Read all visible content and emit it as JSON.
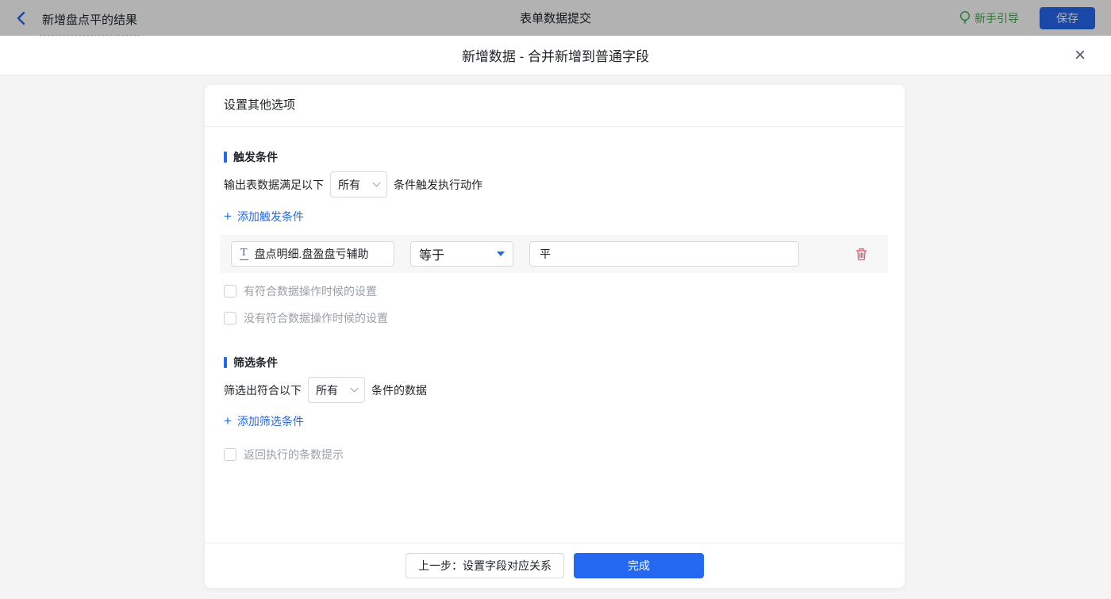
{
  "topbar": {
    "back_title": "新增盘点平的结果",
    "center_title": "表单数据提交",
    "guide_label": "新手引导",
    "save_label": "保存"
  },
  "modal": {
    "title": "新增数据 - 合并新增到普通字段"
  },
  "card": {
    "header": "设置其他选项",
    "trigger": {
      "title": "触发条件",
      "sentence_prefix": "输出表数据满足以下",
      "match_value": "所有",
      "sentence_suffix": "条件触发执行动作",
      "add_label": "添加触发条件",
      "condition": {
        "field": "盘点明细.盘盈盘亏辅助",
        "operator": "等于",
        "value": "平"
      },
      "checkbox_match": "有符合数据操作时候的设置",
      "checkbox_nomatch": "没有符合数据操作时候的设置"
    },
    "filter": {
      "title": "筛选条件",
      "sentence_prefix": "筛选出符合以下",
      "match_value": "所有",
      "sentence_suffix": "条件的数据",
      "add_label": "添加筛选条件",
      "checkbox_count": "返回执行的条数提示"
    },
    "footer": {
      "prev_label": "上一步：设置字段对应关系",
      "done_label": "完成"
    }
  },
  "icons": {
    "plus_glyph": "+",
    "close_glyph": "×",
    "text_field_glyph": "T"
  },
  "colors": {
    "accent_blue": "#2468f2",
    "guide_green": "#3cb14a",
    "danger_red": "#f0566b"
  }
}
